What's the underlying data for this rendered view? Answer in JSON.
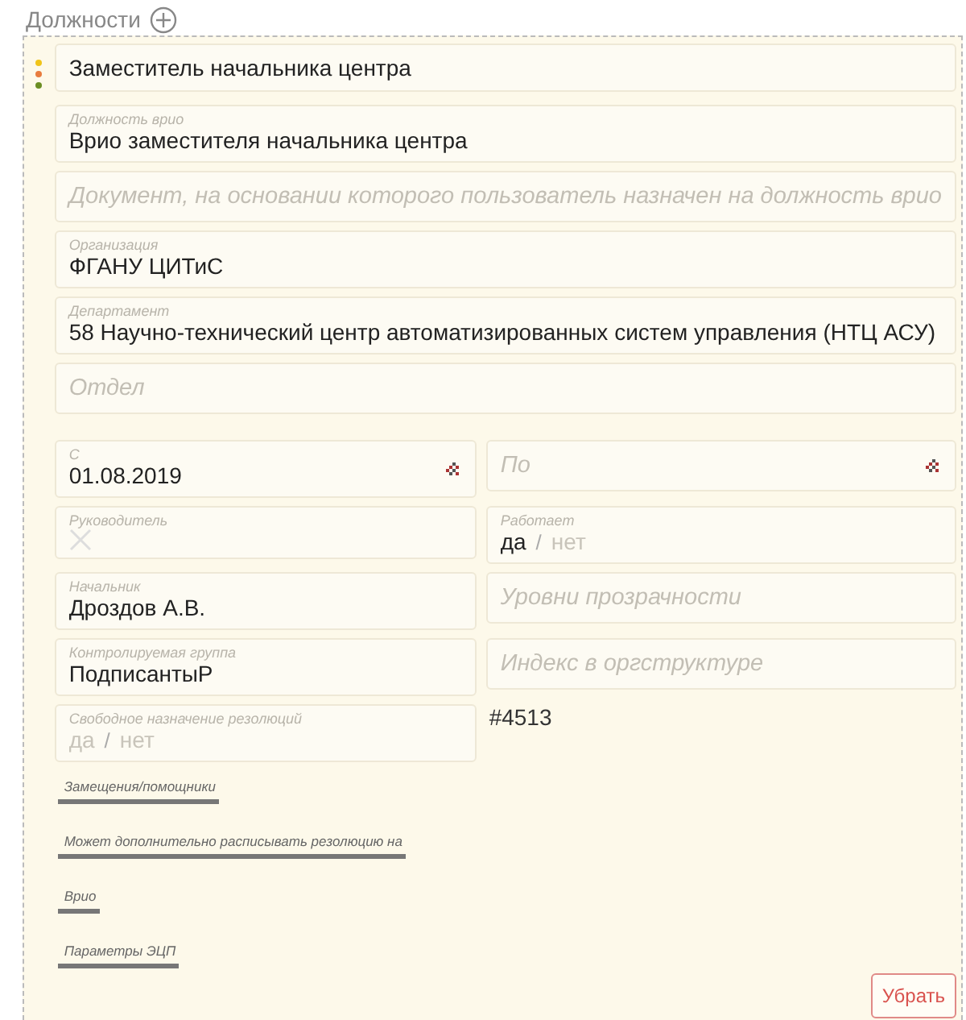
{
  "header": {
    "title": "Должности"
  },
  "position": {
    "title": "Заместитель начальника центра"
  },
  "fields": [
    {
      "kind": "text",
      "label": "Должность врио",
      "value": "Врио заместителя начальника центра"
    },
    {
      "kind": "text",
      "placeholder": "Документ, на основании которого пользователь назначен на должность врио"
    },
    {
      "kind": "text",
      "label": "Организация",
      "value": "ФГАНУ ЦИТиС"
    },
    {
      "kind": "text",
      "label": "Департамент",
      "value": "58 Научно-технический центр автоматизированных систем управления (НТЦ АСУ)"
    },
    {
      "kind": "text",
      "placeholder": "Отдел"
    }
  ],
  "grid": [
    {
      "kind": "date",
      "label": "С",
      "value": "01.08.2019"
    },
    {
      "kind": "date",
      "placeholder": "По"
    },
    {
      "kind": "check",
      "label": "Руководитель",
      "checked": false
    },
    {
      "kind": "toggle",
      "label": "Работает",
      "separator": "/",
      "options": [
        {
          "label": "да",
          "selected": true
        },
        {
          "label": "нет",
          "selected": false
        }
      ]
    },
    {
      "kind": "text",
      "label": "Начальник",
      "value": "Дроздов А.В."
    },
    {
      "kind": "text",
      "placeholder": "Уровни прозрачности"
    },
    {
      "kind": "text",
      "label": "Контролируемая группа",
      "value": "ПодписантыР"
    },
    {
      "kind": "text",
      "placeholder": "Индекс в оргструктуре"
    },
    {
      "kind": "toggle",
      "label": "Свободное назначение резолюций",
      "separator": "/",
      "options": [
        {
          "label": "да",
          "selected": false
        },
        {
          "label": "нет",
          "selected": false
        }
      ]
    },
    {
      "kind": "note",
      "value": "#4513"
    }
  ],
  "sections": [
    "Замещения/помощники",
    "Может дополнительно расписывать резолюцию на",
    "Врио",
    "Параметры ЭЦП"
  ],
  "button": {
    "label": "Убрать"
  }
}
